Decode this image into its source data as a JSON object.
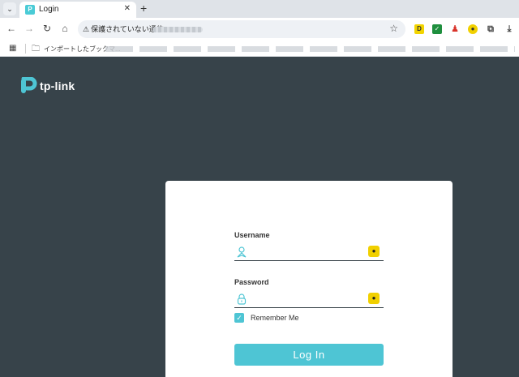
{
  "browser": {
    "tab_title": "Login",
    "tab_favicon": "tp-link-favicon",
    "security_text": "保護されていない通信",
    "bookmarks_folder": "インポートしたブックマ...",
    "extensions": [
      "ext-yellow-icon",
      "ext-check-icon",
      "ext-red-icon",
      "ext-yellow-round-icon",
      "puzzle-icon",
      "download-icon"
    ]
  },
  "page": {
    "logo_text": "tp-link",
    "username_label": "Username",
    "password_label": "Password",
    "remember_label": "Remember Me",
    "remember_checked": true,
    "login_button": "Log In",
    "accent_color": "#4ec5d4",
    "background_color": "#37434a"
  }
}
